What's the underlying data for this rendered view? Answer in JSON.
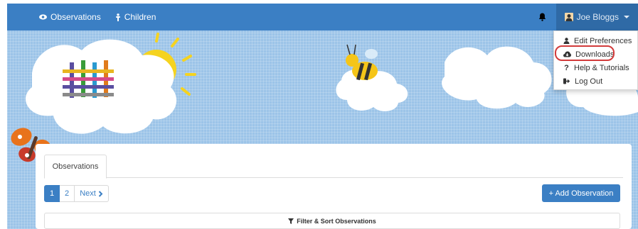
{
  "navbar": {
    "items": [
      {
        "label": "Observations",
        "icon": "eye-icon"
      },
      {
        "label": "Children",
        "icon": "child-icon"
      }
    ],
    "user": {
      "name": "Joe Bloggs",
      "icon": "user-icon"
    },
    "notification_icon": "bell-icon"
  },
  "user_menu": {
    "items": [
      {
        "label": "Edit Preferences",
        "icon": "user-icon"
      },
      {
        "label": "Downloads",
        "icon": "cloud-download-icon",
        "highlighted": true
      },
      {
        "label": "Help & Tutorials",
        "icon": "question-icon"
      },
      {
        "label": "Log Out",
        "icon": "logout-icon"
      }
    ]
  },
  "main": {
    "tabs": [
      {
        "label": "Observations",
        "active": true
      }
    ],
    "pagination": {
      "pages": [
        "1",
        "2"
      ],
      "current": "1",
      "next_label": "Next"
    },
    "add_button_label": "+ Add Observation",
    "filter_label": "Filter & Sort Observations"
  },
  "colors": {
    "primary": "#3b7fc4",
    "banner_bg": "#9cc4e8",
    "highlight_ring": "#d23a3a"
  }
}
